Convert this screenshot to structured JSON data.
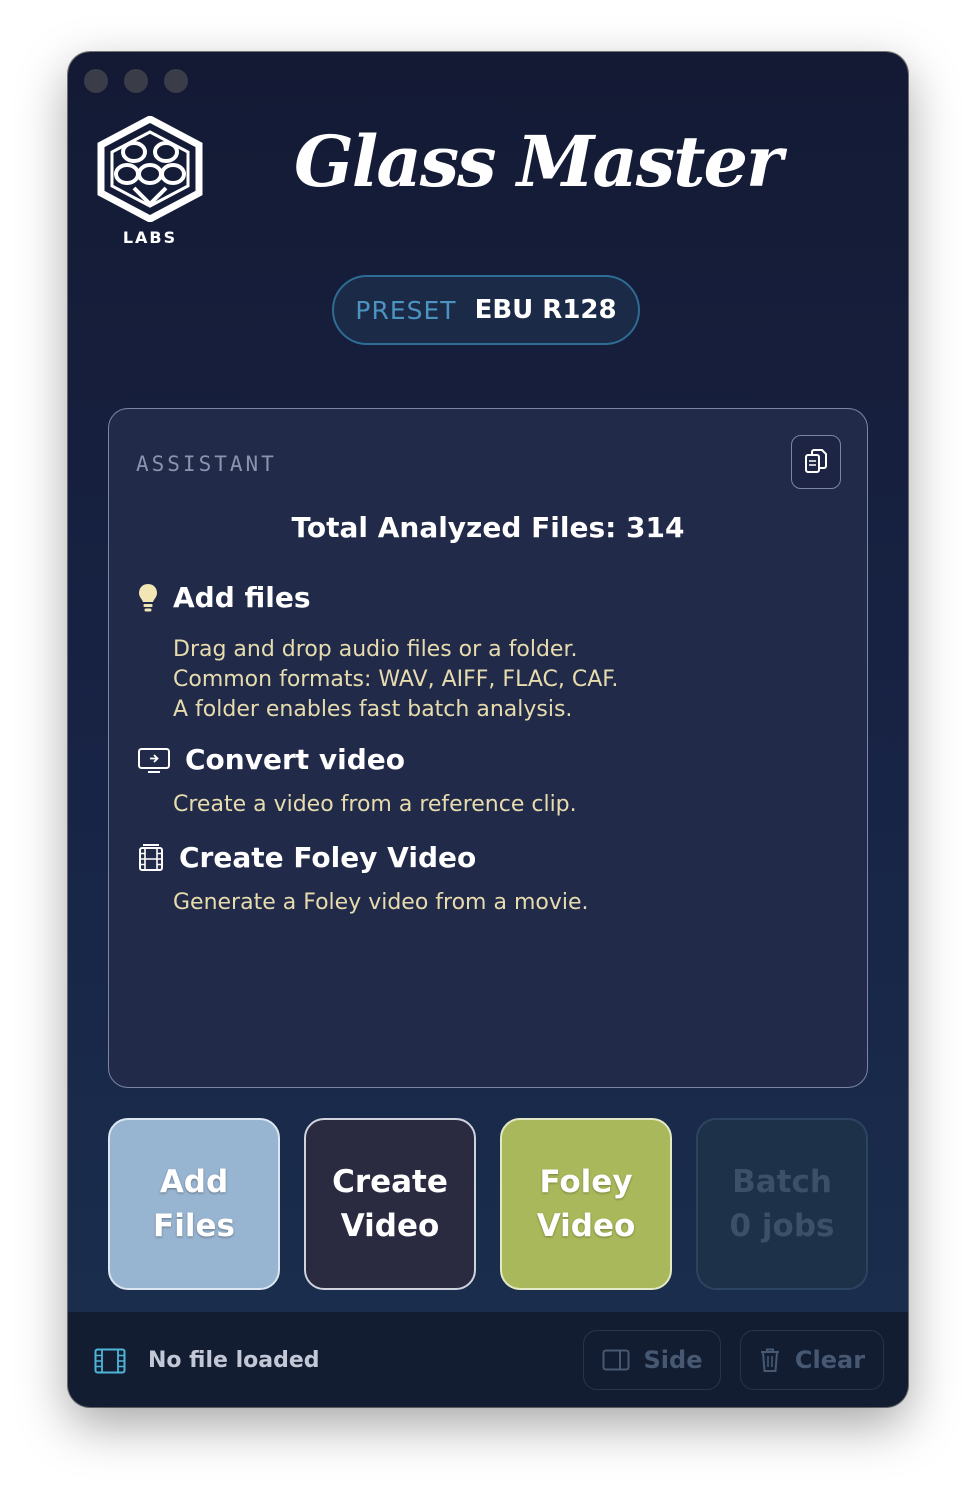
{
  "app": {
    "title": "Glass Master",
    "logo_text": "LABS"
  },
  "preset": {
    "label": "PRESET",
    "value": "EBU R128"
  },
  "assistant": {
    "label": "ASSISTANT",
    "total": "Total Analyzed Files: 314",
    "sections": [
      {
        "icon": "lightbulb-icon",
        "title": "Add files",
        "lines": [
          "Drag and drop audio files or a folder.",
          "Common formats: WAV, AIFF, FLAC, CAF.",
          "A folder enables fast batch analysis."
        ]
      },
      {
        "icon": "monitor-icon",
        "title": "Convert video",
        "lines": [
          "Create a video from a reference clip."
        ]
      },
      {
        "icon": "film-icon",
        "title": "Create Foley Video",
        "lines": [
          "Generate a Foley video from a movie."
        ]
      }
    ]
  },
  "actions": {
    "add_files": [
      "Add",
      "Files"
    ],
    "create_video": [
      "Create",
      "Video"
    ],
    "foley_video": [
      "Foley",
      "Video"
    ],
    "batch": [
      "Batch",
      "0 jobs"
    ]
  },
  "status": {
    "text": "No file loaded",
    "side_label": "Side",
    "clear_label": "Clear"
  },
  "colors": {
    "accent_blue": "#4d93c2",
    "tip_text": "#e7dcae",
    "add_files_bg": "#97b4d0",
    "foley_bg": "#a8b85a",
    "create_bg": "#2a2a40"
  }
}
